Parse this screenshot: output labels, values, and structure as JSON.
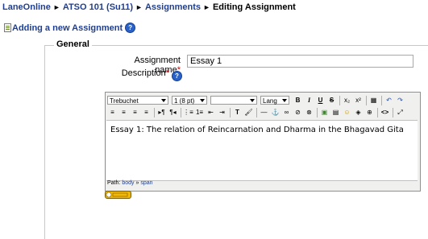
{
  "breadcrumb": {
    "items": [
      "LaneOnline",
      "ATSO 101 (Su11)",
      "Assignments"
    ],
    "current": "Editing Assignment",
    "separator": "►"
  },
  "page_header": {
    "title": "Adding a new Assignment",
    "help_icon": "?"
  },
  "form": {
    "legend": "General",
    "assignment_name": {
      "label": "Assignment name",
      "required_mark": "*",
      "value": "Essay 1"
    },
    "description": {
      "label": "Description",
      "required_mark": "*",
      "help_icon": "?"
    }
  },
  "editor": {
    "font_family": "Trebuchet",
    "font_size": "1 (8 pt)",
    "heading": "",
    "lang": "Lang",
    "toolbar_row1": [
      "B",
      "I",
      "U",
      "S",
      "x₂",
      "x²",
      "▦",
      "↶",
      "↷"
    ],
    "toolbar_row2": [
      "≡",
      "≡",
      "≡",
      "≡",
      "▸¶",
      "¶◂",
      "⋮≡",
      "1≡",
      "⇤",
      "⇥",
      "T",
      "🖌",
      "—",
      "⚓",
      "∞",
      "⊘",
      "⊗",
      "▣",
      "▤",
      "☺",
      "◈",
      "⊕",
      "<>",
      "⤢"
    ],
    "content": "Essay 1: The relation of Reincarnation and Dharma in the Bhagavad Gita",
    "path_label": "Path:",
    "path_items": [
      "body",
      "span"
    ],
    "path_separator": "»"
  },
  "colors": {
    "link": "#1f3e8f",
    "required": "#cc0000",
    "keyboard_badge": "#f3b800"
  }
}
